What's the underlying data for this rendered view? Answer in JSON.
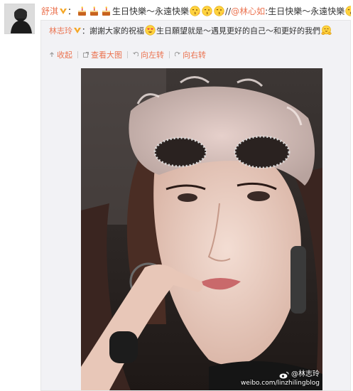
{
  "post": {
    "author": "舒淇",
    "colon": "：",
    "text_main": "生日快樂～永遠快樂",
    "repost_sep": "//",
    "mention": "@林心如",
    "repost_colon": ":",
    "repost_text": "生日快樂～永遠快樂",
    "emoji_icons": [
      "cake-emoji",
      "cake-emoji",
      "cake-emoji",
      "kiss-emoji",
      "kiss-emoji",
      "kiss-emoji",
      "kiss-emoji",
      "kiss-emoji",
      "kiss-emoji"
    ]
  },
  "forward": {
    "author": "林志玲",
    "colon": "：",
    "text_part1": "謝謝大家的祝福",
    "text_part2": "生日願望就是～遇見更好的自己～和更好的我們",
    "emoji_icons": [
      "heart-eyes-emoji",
      "hug-emoji"
    ]
  },
  "toolbar": {
    "collapse_label": "收起",
    "view_large_label": "查看大图",
    "rotate_left_label": "向左转",
    "rotate_right_label": "向右转"
  },
  "image": {
    "watermark_name": "@林志玲",
    "watermark_url": "weibo.com/linzhilingblog"
  },
  "colors": {
    "link": "#eb7350",
    "forward_bg": "#f2f2f5",
    "text": "#333333"
  }
}
